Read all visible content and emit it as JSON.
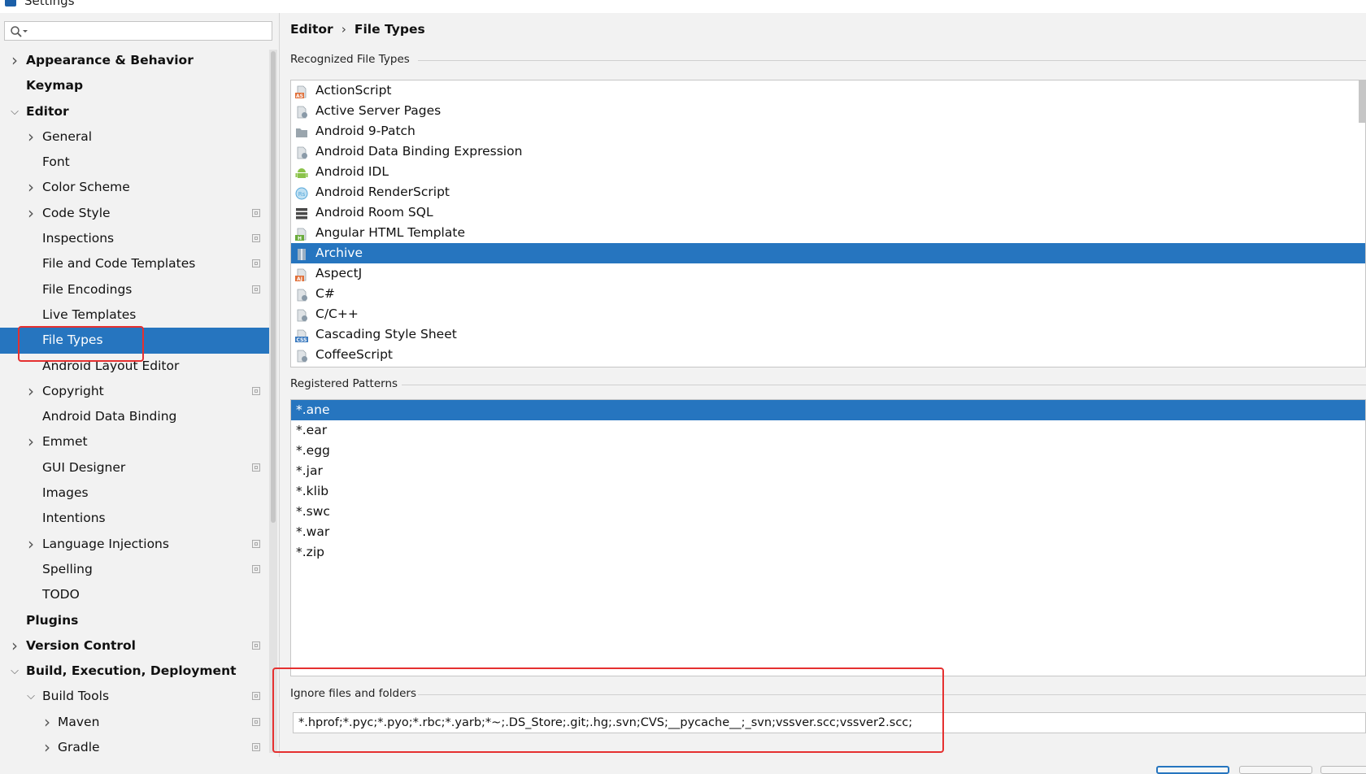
{
  "window": {
    "title": "Settings"
  },
  "search": {
    "placeholder": ""
  },
  "sidebar": {
    "items": [
      {
        "label": "Appearance & Behavior",
        "level": 0,
        "bold": true,
        "arrow": "right",
        "cfg": false,
        "selected": false
      },
      {
        "label": "Keymap",
        "level": 0,
        "bold": true,
        "arrow": "",
        "cfg": false,
        "selected": false
      },
      {
        "label": "Editor",
        "level": 0,
        "bold": true,
        "arrow": "down",
        "cfg": false,
        "selected": false
      },
      {
        "label": "General",
        "level": 1,
        "bold": false,
        "arrow": "right",
        "cfg": false,
        "selected": false
      },
      {
        "label": "Font",
        "level": 1,
        "bold": false,
        "arrow": "",
        "cfg": false,
        "selected": false
      },
      {
        "label": "Color Scheme",
        "level": 1,
        "bold": false,
        "arrow": "right",
        "cfg": false,
        "selected": false
      },
      {
        "label": "Code Style",
        "level": 1,
        "bold": false,
        "arrow": "right",
        "cfg": true,
        "selected": false
      },
      {
        "label": "Inspections",
        "level": 1,
        "bold": false,
        "arrow": "",
        "cfg": true,
        "selected": false
      },
      {
        "label": "File and Code Templates",
        "level": 1,
        "bold": false,
        "arrow": "",
        "cfg": true,
        "selected": false
      },
      {
        "label": "File Encodings",
        "level": 1,
        "bold": false,
        "arrow": "",
        "cfg": true,
        "selected": false
      },
      {
        "label": "Live Templates",
        "level": 1,
        "bold": false,
        "arrow": "",
        "cfg": false,
        "selected": false
      },
      {
        "label": "File Types",
        "level": 1,
        "bold": false,
        "arrow": "",
        "cfg": false,
        "selected": true
      },
      {
        "label": "Android Layout Editor",
        "level": 1,
        "bold": false,
        "arrow": "",
        "cfg": false,
        "selected": false
      },
      {
        "label": "Copyright",
        "level": 1,
        "bold": false,
        "arrow": "right",
        "cfg": true,
        "selected": false
      },
      {
        "label": "Android Data Binding",
        "level": 1,
        "bold": false,
        "arrow": "",
        "cfg": false,
        "selected": false
      },
      {
        "label": "Emmet",
        "level": 1,
        "bold": false,
        "arrow": "right",
        "cfg": false,
        "selected": false
      },
      {
        "label": "GUI Designer",
        "level": 1,
        "bold": false,
        "arrow": "",
        "cfg": true,
        "selected": false
      },
      {
        "label": "Images",
        "level": 1,
        "bold": false,
        "arrow": "",
        "cfg": false,
        "selected": false
      },
      {
        "label": "Intentions",
        "level": 1,
        "bold": false,
        "arrow": "",
        "cfg": false,
        "selected": false
      },
      {
        "label": "Language Injections",
        "level": 1,
        "bold": false,
        "arrow": "right",
        "cfg": true,
        "selected": false
      },
      {
        "label": "Spelling",
        "level": 1,
        "bold": false,
        "arrow": "",
        "cfg": true,
        "selected": false
      },
      {
        "label": "TODO",
        "level": 1,
        "bold": false,
        "arrow": "",
        "cfg": false,
        "selected": false
      },
      {
        "label": "Plugins",
        "level": 0,
        "bold": true,
        "arrow": "",
        "cfg": false,
        "selected": false
      },
      {
        "label": "Version Control",
        "level": 0,
        "bold": true,
        "arrow": "right",
        "cfg": true,
        "selected": false
      },
      {
        "label": "Build, Execution, Deployment",
        "level": 0,
        "bold": true,
        "arrow": "down",
        "cfg": false,
        "selected": false
      },
      {
        "label": "Build Tools",
        "level": 1,
        "bold": false,
        "arrow": "down",
        "cfg": true,
        "selected": false
      },
      {
        "label": "Maven",
        "level": 2,
        "bold": false,
        "arrow": "right",
        "cfg": true,
        "selected": false
      },
      {
        "label": "Gradle",
        "level": 2,
        "bold": false,
        "arrow": "right",
        "cfg": true,
        "selected": false
      }
    ]
  },
  "breadcrumb": {
    "parent": "Editor",
    "separator": "›",
    "current": "File Types"
  },
  "recognized": {
    "title": "Recognized File Types",
    "items": [
      {
        "name": "ActionScript",
        "icon": "actionscript-icon",
        "color": "#e0703a",
        "badge": "AS",
        "selected": false
      },
      {
        "name": "Active Server Pages",
        "icon": "asp-file-icon",
        "color": "#8a9aa8",
        "badge": "",
        "selected": false
      },
      {
        "name": "Android 9-Patch",
        "icon": "folder-icon",
        "color": "#9aa5ad",
        "badge": "",
        "selected": false
      },
      {
        "name": "Android Data Binding Expression",
        "icon": "data-binding-file-icon",
        "color": "#8a9aa8",
        "badge": "",
        "selected": false
      },
      {
        "name": "Android IDL",
        "icon": "android-icon",
        "color": "#8bc34a",
        "badge": "",
        "selected": false
      },
      {
        "name": "Android RenderScript",
        "icon": "renderscript-icon",
        "color": "#55a7d9",
        "badge": "Rs",
        "selected": false
      },
      {
        "name": "Android Room SQL",
        "icon": "database-icon",
        "color": "#4a4a4a",
        "badge": "",
        "selected": false
      },
      {
        "name": "Angular HTML Template",
        "icon": "html-file-icon",
        "color": "#6aab3c",
        "badge": "H",
        "selected": false
      },
      {
        "name": "Archive",
        "icon": "archive-icon",
        "color": "#9ab0c4",
        "badge": "",
        "selected": true
      },
      {
        "name": "AspectJ",
        "icon": "aspectj-icon",
        "color": "#e0703a",
        "badge": "AJ",
        "selected": false
      },
      {
        "name": "C#",
        "icon": "csharp-file-icon",
        "color": "#8a9aa8",
        "badge": "",
        "selected": false
      },
      {
        "name": "C/C++",
        "icon": "cpp-file-icon",
        "color": "#8a9aa8",
        "badge": "",
        "selected": false
      },
      {
        "name": "Cascading Style Sheet",
        "icon": "css-file-icon",
        "color": "#3e7cc0",
        "badge": "CSS",
        "selected": false
      },
      {
        "name": "CoffeeScript",
        "icon": "coffeescript-icon",
        "color": "#8a9aa8",
        "badge": "",
        "selected": false
      }
    ]
  },
  "patterns": {
    "title": "Registered Patterns",
    "items": [
      {
        "value": "*.ane",
        "selected": true
      },
      {
        "value": "*.ear",
        "selected": false
      },
      {
        "value": "*.egg",
        "selected": false
      },
      {
        "value": "*.jar",
        "selected": false
      },
      {
        "value": "*.klib",
        "selected": false
      },
      {
        "value": "*.swc",
        "selected": false
      },
      {
        "value": "*.war",
        "selected": false
      },
      {
        "value": "*.zip",
        "selected": false
      }
    ]
  },
  "ignore": {
    "title": "Ignore files and folders",
    "value": "*.hprof;*.pyc;*.pyo;*.rbc;*.yarb;*~;.DS_Store;.git;.hg;.svn;CVS;__pycache__;_svn;vssver.scc;vssver2.scc;"
  },
  "colors": {
    "accent": "#2675bf",
    "highlight": "#e53030"
  }
}
